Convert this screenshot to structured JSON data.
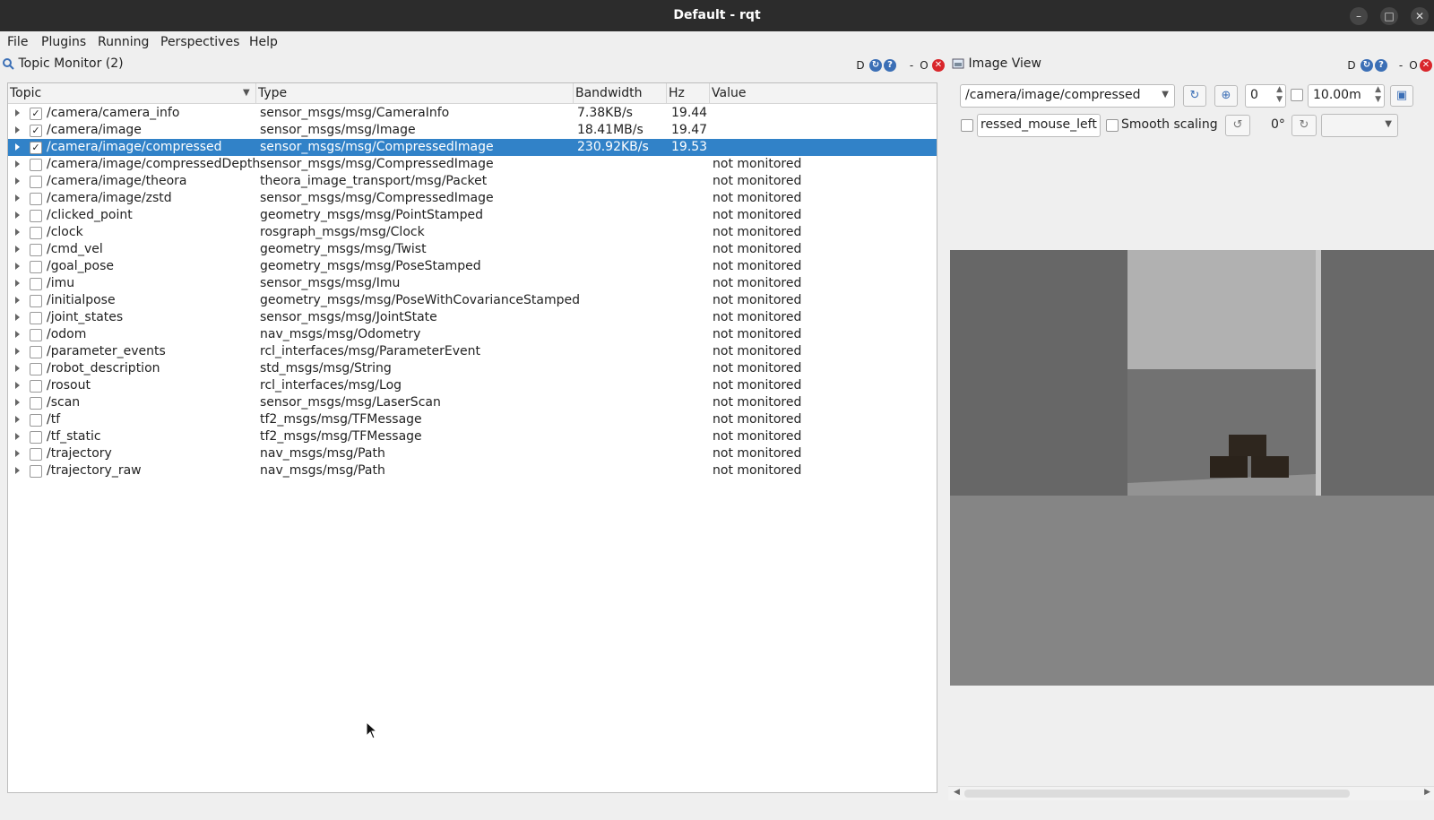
{
  "window": {
    "title": "Default - rqt"
  },
  "menu": [
    "File",
    "Plugins",
    "Running",
    "Perspectives",
    "Help"
  ],
  "topic_monitor": {
    "title": "Topic Monitor (2)",
    "columns": [
      "Topic",
      "Type",
      "Bandwidth",
      "Hz",
      "Value"
    ],
    "rows": [
      {
        "topic": "/camera/camera_info",
        "type": "sensor_msgs/msg/CameraInfo",
        "bandwidth": "7.38KB/s",
        "hz": "19.44",
        "value": "",
        "checked": "✓"
      },
      {
        "topic": "/camera/image",
        "type": "sensor_msgs/msg/Image",
        "bandwidth": "18.41MB/s",
        "hz": "19.47",
        "value": "",
        "checked": "✓"
      },
      {
        "topic": "/camera/image/compressed",
        "type": "sensor_msgs/msg/CompressedImage",
        "bandwidth": "230.92KB/s",
        "hz": "19.53",
        "value": "",
        "checked": "✓"
      },
      {
        "topic": "/camera/image/compressedDepth",
        "type": "sensor_msgs/msg/CompressedImage",
        "bandwidth": "",
        "hz": "",
        "value": "not monitored",
        "checked": ""
      },
      {
        "topic": "/camera/image/theora",
        "type": "theora_image_transport/msg/Packet",
        "bandwidth": "",
        "hz": "",
        "value": "not monitored",
        "checked": ""
      },
      {
        "topic": "/camera/image/zstd",
        "type": "sensor_msgs/msg/CompressedImage",
        "bandwidth": "",
        "hz": "",
        "value": "not monitored",
        "checked": ""
      },
      {
        "topic": "/clicked_point",
        "type": "geometry_msgs/msg/PointStamped",
        "bandwidth": "",
        "hz": "",
        "value": "not monitored",
        "checked": ""
      },
      {
        "topic": "/clock",
        "type": "rosgraph_msgs/msg/Clock",
        "bandwidth": "",
        "hz": "",
        "value": "not monitored",
        "checked": ""
      },
      {
        "topic": "/cmd_vel",
        "type": "geometry_msgs/msg/Twist",
        "bandwidth": "",
        "hz": "",
        "value": "not monitored",
        "checked": ""
      },
      {
        "topic": "/goal_pose",
        "type": "geometry_msgs/msg/PoseStamped",
        "bandwidth": "",
        "hz": "",
        "value": "not monitored",
        "checked": ""
      },
      {
        "topic": "/imu",
        "type": "sensor_msgs/msg/Imu",
        "bandwidth": "",
        "hz": "",
        "value": "not monitored",
        "checked": ""
      },
      {
        "topic": "/initialpose",
        "type": "geometry_msgs/msg/PoseWithCovarianceStamped",
        "bandwidth": "",
        "hz": "",
        "value": "not monitored",
        "checked": ""
      },
      {
        "topic": "/joint_states",
        "type": "sensor_msgs/msg/JointState",
        "bandwidth": "",
        "hz": "",
        "value": "not monitored",
        "checked": ""
      },
      {
        "topic": "/odom",
        "type": "nav_msgs/msg/Odometry",
        "bandwidth": "",
        "hz": "",
        "value": "not monitored",
        "checked": ""
      },
      {
        "topic": "/parameter_events",
        "type": "rcl_interfaces/msg/ParameterEvent",
        "bandwidth": "",
        "hz": "",
        "value": "not monitored",
        "checked": ""
      },
      {
        "topic": "/robot_description",
        "type": "std_msgs/msg/String",
        "bandwidth": "",
        "hz": "",
        "value": "not monitored",
        "checked": ""
      },
      {
        "topic": "/rosout",
        "type": "rcl_interfaces/msg/Log",
        "bandwidth": "",
        "hz": "",
        "value": "not monitored",
        "checked": ""
      },
      {
        "topic": "/scan",
        "type": "sensor_msgs/msg/LaserScan",
        "bandwidth": "",
        "hz": "",
        "value": "not monitored",
        "checked": ""
      },
      {
        "topic": "/tf",
        "type": "tf2_msgs/msg/TFMessage",
        "bandwidth": "",
        "hz": "",
        "value": "not monitored",
        "checked": ""
      },
      {
        "topic": "/tf_static",
        "type": "tf2_msgs/msg/TFMessage",
        "bandwidth": "",
        "hz": "",
        "value": "not monitored",
        "checked": ""
      },
      {
        "topic": "/trajectory",
        "type": "nav_msgs/msg/Path",
        "bandwidth": "",
        "hz": "",
        "value": "not monitored",
        "checked": ""
      },
      {
        "topic": "/trajectory_raw",
        "type": "nav_msgs/msg/Path",
        "bandwidth": "",
        "hz": "",
        "value": "not monitored",
        "checked": ""
      }
    ]
  },
  "image_view": {
    "title": "Image View",
    "topic": "/camera/image/compressed",
    "spin_value": "0",
    "max_range": "10.00m",
    "mouse_topic": "ressed_mouse_left",
    "smooth_scaling": "Smooth scaling",
    "rotation": "0°"
  },
  "dock_controls": {
    "d": "D",
    "minimize": "-",
    "float": "O"
  },
  "icons": {
    "close": "close-icon",
    "help": "help-icon",
    "reload": "reload-icon",
    "zoom": "zoom-icon",
    "save": "save-icon"
  },
  "colors": {
    "selection": "#3182c8",
    "titlebar": "#2c2c2c",
    "close": "#d9262b"
  }
}
